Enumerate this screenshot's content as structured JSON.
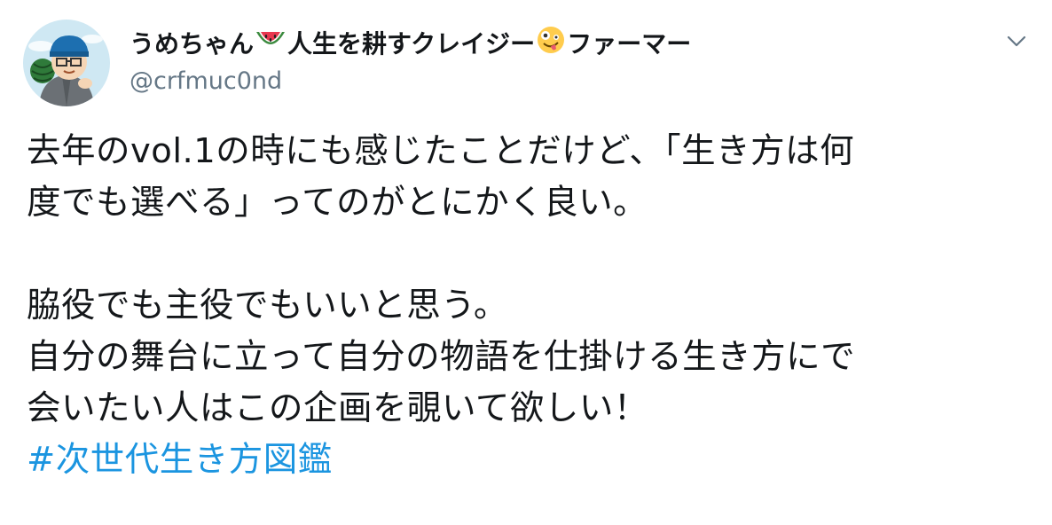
{
  "tweet": {
    "author": {
      "name_part1": "うめちゃん",
      "name_part2": "人生を耕すクレイジー",
      "name_part3": "ファーマー",
      "emoji1": "watermelon-emoji",
      "emoji2": "zany-face-emoji",
      "handle": "@crfmuc0nd"
    },
    "text_lines": [
      "去年のvol.1の時にも感じたことだけど、「生き方は何",
      "度でも選べる」ってのがとにかく良い。",
      "",
      "脇役でも主役でもいいと思う。",
      "自分の舞台に立って自分の物語を仕掛ける生き方にで",
      "会いたい人はこの企画を覗いて欲しい！"
    ],
    "hashtag": "#次世代生き方図鑑"
  },
  "colors": {
    "text": "#14171a",
    "secondary": "#657786",
    "link": "#1b95e0"
  },
  "icons": {
    "caret": "chevron-down-icon"
  }
}
